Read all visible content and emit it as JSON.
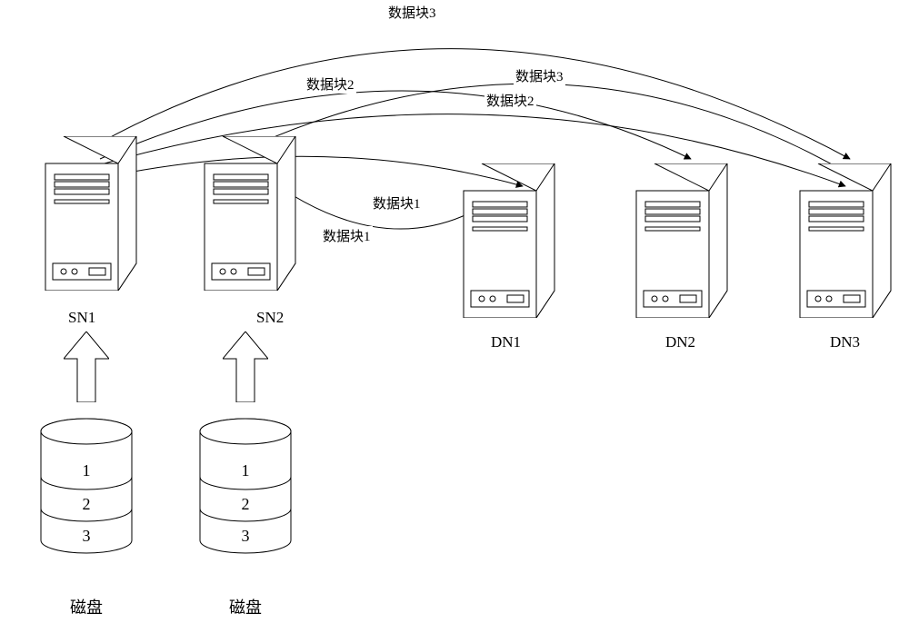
{
  "nodes": {
    "sn1": {
      "label": "SN1"
    },
    "sn2": {
      "label": "SN2"
    },
    "dn1": {
      "label": "DN1"
    },
    "dn2": {
      "label": "DN2"
    },
    "dn3": {
      "label": "DN3"
    }
  },
  "disks": {
    "label": "磁盘",
    "rows": {
      "r1": "1",
      "r2": "2",
      "r3": "3"
    }
  },
  "edges": {
    "e1": "数据块3",
    "e2": "数据块2",
    "e3": "数据块3",
    "e4": "数据块2",
    "e5": "数据块1",
    "e6": "数据块1"
  }
}
